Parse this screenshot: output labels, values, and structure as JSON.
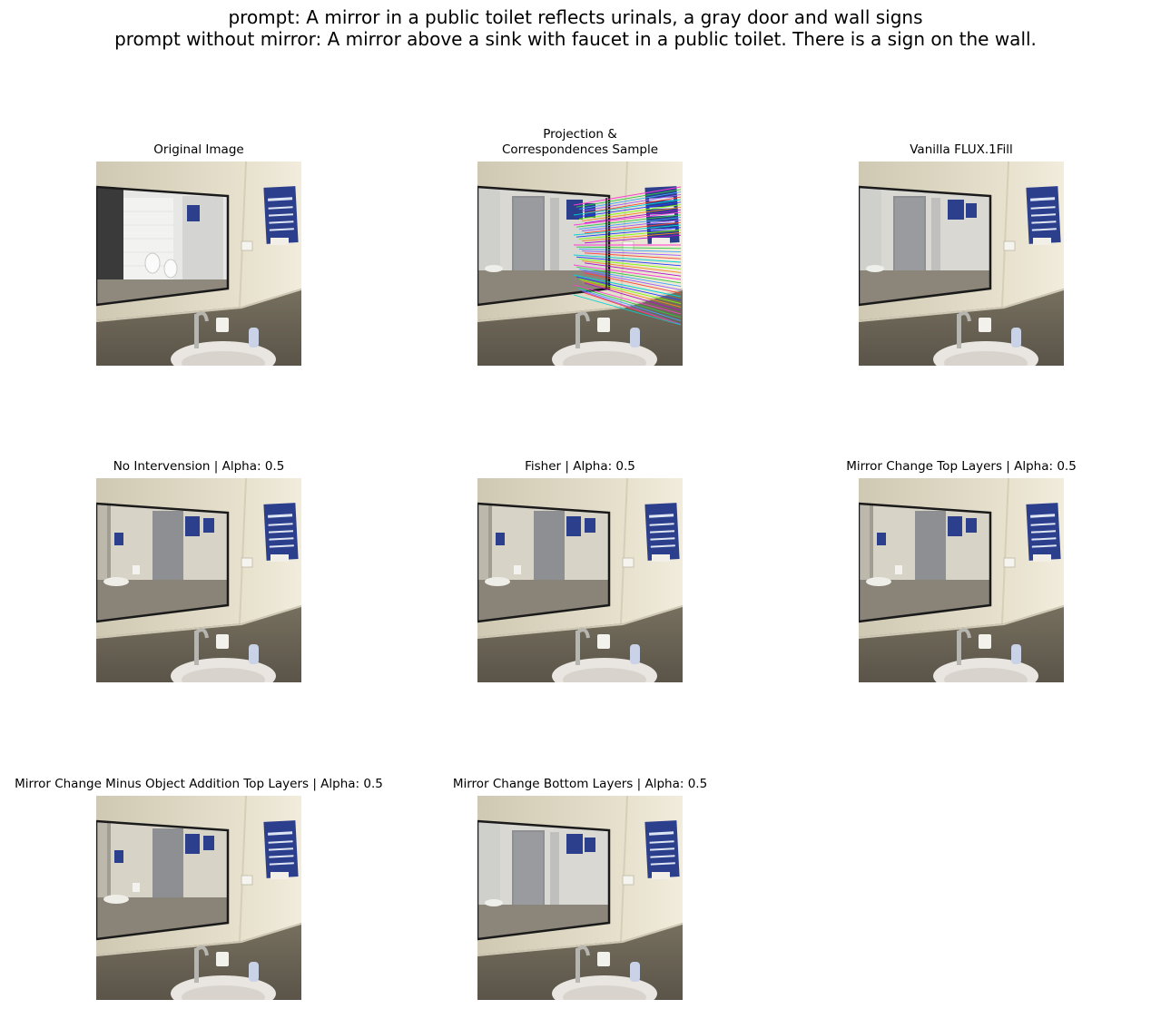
{
  "figure": {
    "prompt_line": "prompt: A mirror in a public toilet reflects urinals, a gray door and wall signs",
    "prompt_without_mirror_line": "prompt without mirror: A mirror above a sink with faucet in a public toilet. There is a sign on the wall."
  },
  "panels": [
    {
      "id": "original",
      "title": "Original Image",
      "reflection": "urinals"
    },
    {
      "id": "projection",
      "title_line1": "Projection &",
      "title_line2": "Correspondences Sample",
      "reflection": "door",
      "overlay": "correspondence-lines"
    },
    {
      "id": "vanilla",
      "title": "Vanilla FLUX.1Fill",
      "reflection": "door"
    },
    {
      "id": "no-intervention",
      "title": "No Intervension | Alpha: 0.5",
      "reflection": "sink-room"
    },
    {
      "id": "fisher",
      "title": "Fisher | Alpha: 0.5",
      "reflection": "sink-room"
    },
    {
      "id": "mirror-top",
      "title": "Mirror Change Top Layers | Alpha: 0.5",
      "reflection": "sink-room"
    },
    {
      "id": "mirror-minus",
      "title": "Mirror Change Minus Object Addition Top Layers | Alpha: 0.5",
      "reflection": "sink-room"
    },
    {
      "id": "mirror-bottom",
      "title": "Mirror Change Bottom Layers | Alpha: 0.5",
      "reflection": "door-sink"
    }
  ],
  "colors": {
    "wall": "#e8e2cf",
    "counter": "#6b645a",
    "mirror_frame": "#1a1a1a",
    "sign_blue": "#2c3f8c",
    "door_gray": "#8e8f92"
  }
}
